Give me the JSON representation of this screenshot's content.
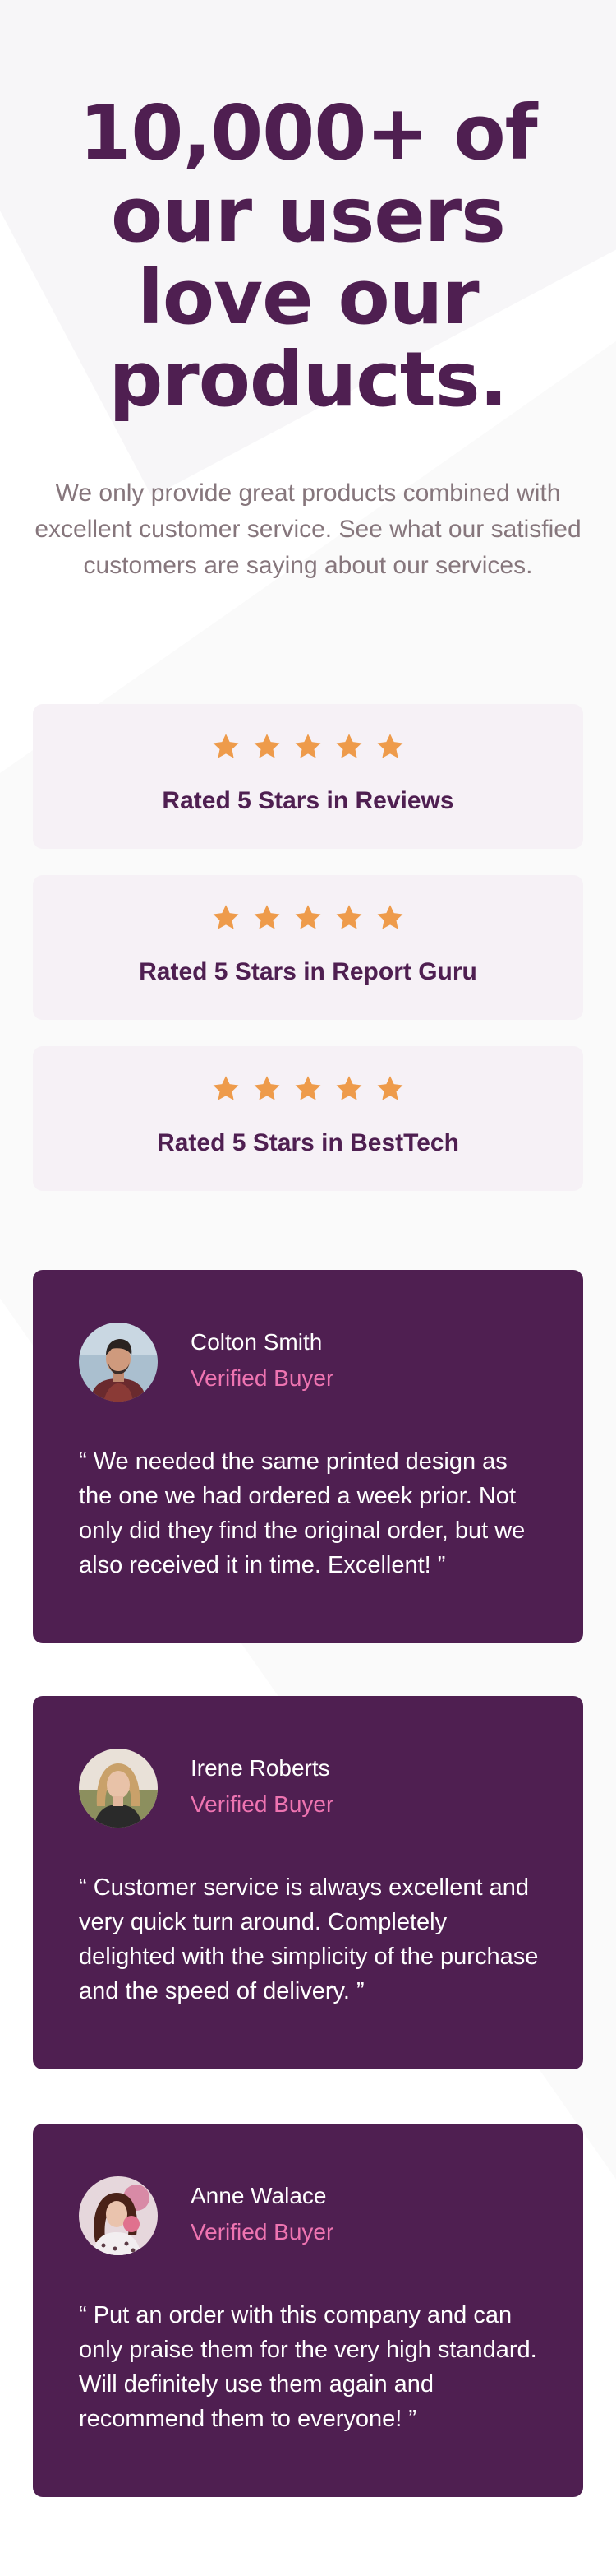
{
  "hero": {
    "title": "10,000+ of our users love our products.",
    "subtitle": "We only provide great products combined with excellent customer service. See what our satisfied customers are saying about our services."
  },
  "ratings": [
    {
      "stars": 5,
      "label": "Rated 5 Stars in Reviews"
    },
    {
      "stars": 5,
      "label": "Rated 5 Stars in Report Guru"
    },
    {
      "stars": 5,
      "label": "Rated 5 Stars in BestTech"
    }
  ],
  "testimonials": [
    {
      "name": "Colton Smith",
      "status": "Verified Buyer",
      "quote": "“ We needed the same printed design as the one we had ordered a week prior. Not only did they find the original order, but we also received it in time. Excellent! ”"
    },
    {
      "name": "Irene Roberts",
      "status": "Verified Buyer",
      "quote": "“ Customer service is always excellent and very quick turn around. Completely delighted with the simplicity of the purchase and the speed of delivery. ”"
    },
    {
      "name": "Anne Walace",
      "status": "Verified Buyer",
      "quote": "“ Put an order with this company and can only praise them for the very high standard. Will definitely use them again and recommend them to everyone! ”"
    }
  ],
  "colors": {
    "primary": "#4f1f51",
    "accent": "#ee74b1",
    "star": "#ee9b4b",
    "card_light": "#f6f1f6",
    "text_muted": "#86767c"
  },
  "icons": {
    "star": "star-icon"
  }
}
